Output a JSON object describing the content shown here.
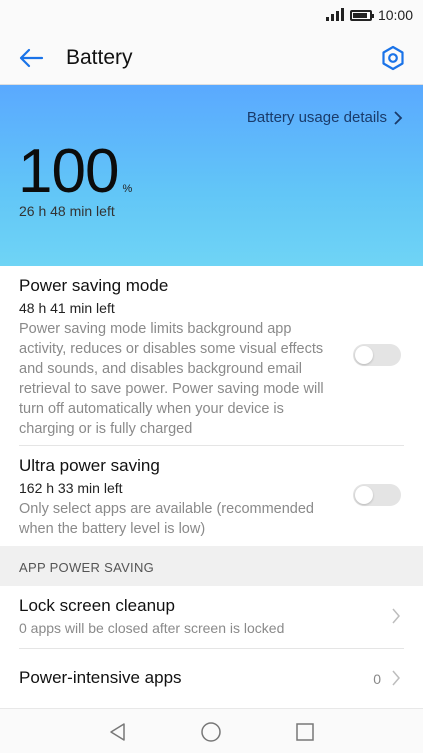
{
  "status_bar": {
    "time": "10:00",
    "battery_level": 1.0,
    "signal_bars": 4
  },
  "app_bar": {
    "title": "Battery"
  },
  "hero": {
    "usage_link": "Battery usage details",
    "percent": "100",
    "percent_sign": "%",
    "time_left": "26 h 48 min left"
  },
  "power_saving": {
    "title": "Power saving mode",
    "subtitle": "48 h 41 min left",
    "description": "Power saving mode limits background app activity, reduces or disables some visual effects and sounds, and disables background email retrieval to save power. Power saving mode will turn off automatically when your device is charging or is fully charged",
    "enabled": false
  },
  "ultra_power_saving": {
    "title": "Ultra power saving",
    "subtitle": "162 h 33 min left",
    "description": "Only select apps are available (recommended when the battery level is low)",
    "enabled": false
  },
  "app_power_saving": {
    "header": "APP POWER SAVING",
    "lock_screen": {
      "title": "Lock screen cleanup",
      "subtitle": "0 apps will be closed after screen is locked"
    },
    "power_intensive": {
      "title": "Power-intensive apps",
      "count": "0"
    }
  },
  "colors": {
    "accent": "#1a73e8",
    "hero_top": "#5aa9ff",
    "hero_bottom": "#6fd4f5"
  }
}
